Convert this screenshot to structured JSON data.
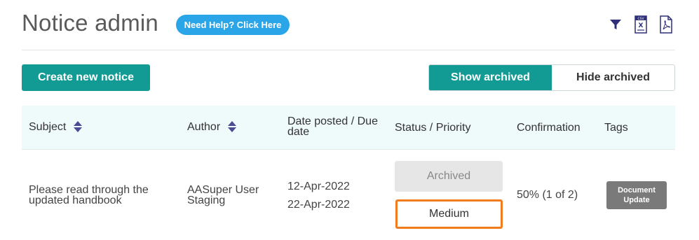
{
  "header": {
    "title": "Notice admin",
    "help_label": "Need Help? Click Here",
    "icons": [
      "filter-icon",
      "excel-export-icon",
      "pdf-export-icon"
    ]
  },
  "toolbar": {
    "create_label": "Create new notice",
    "show_archived_label": "Show archived",
    "hide_archived_label": "Hide archived",
    "selected": "Show archived"
  },
  "table": {
    "columns": {
      "subject": "Subject",
      "author": "Author",
      "date": "Date posted / Due date",
      "status": "Status / Priority",
      "confirmation": "Confirmation",
      "tags": "Tags"
    },
    "rows": [
      {
        "subject": "Please read through the updated handbook",
        "author": "AASuper User Staging",
        "date_posted": "12-Apr-2022",
        "due_date": "22-Apr-2022",
        "status": "Archived",
        "priority": "Medium",
        "confirmation": "50% (1 of 2)",
        "tag": "Document Update"
      }
    ]
  },
  "colors": {
    "accent_teal": "#119b94",
    "help_blue": "#2aa6e8",
    "priority_border": "#f07c1e",
    "header_bg": "#effafb",
    "icon_navy": "#2f2f7a"
  }
}
